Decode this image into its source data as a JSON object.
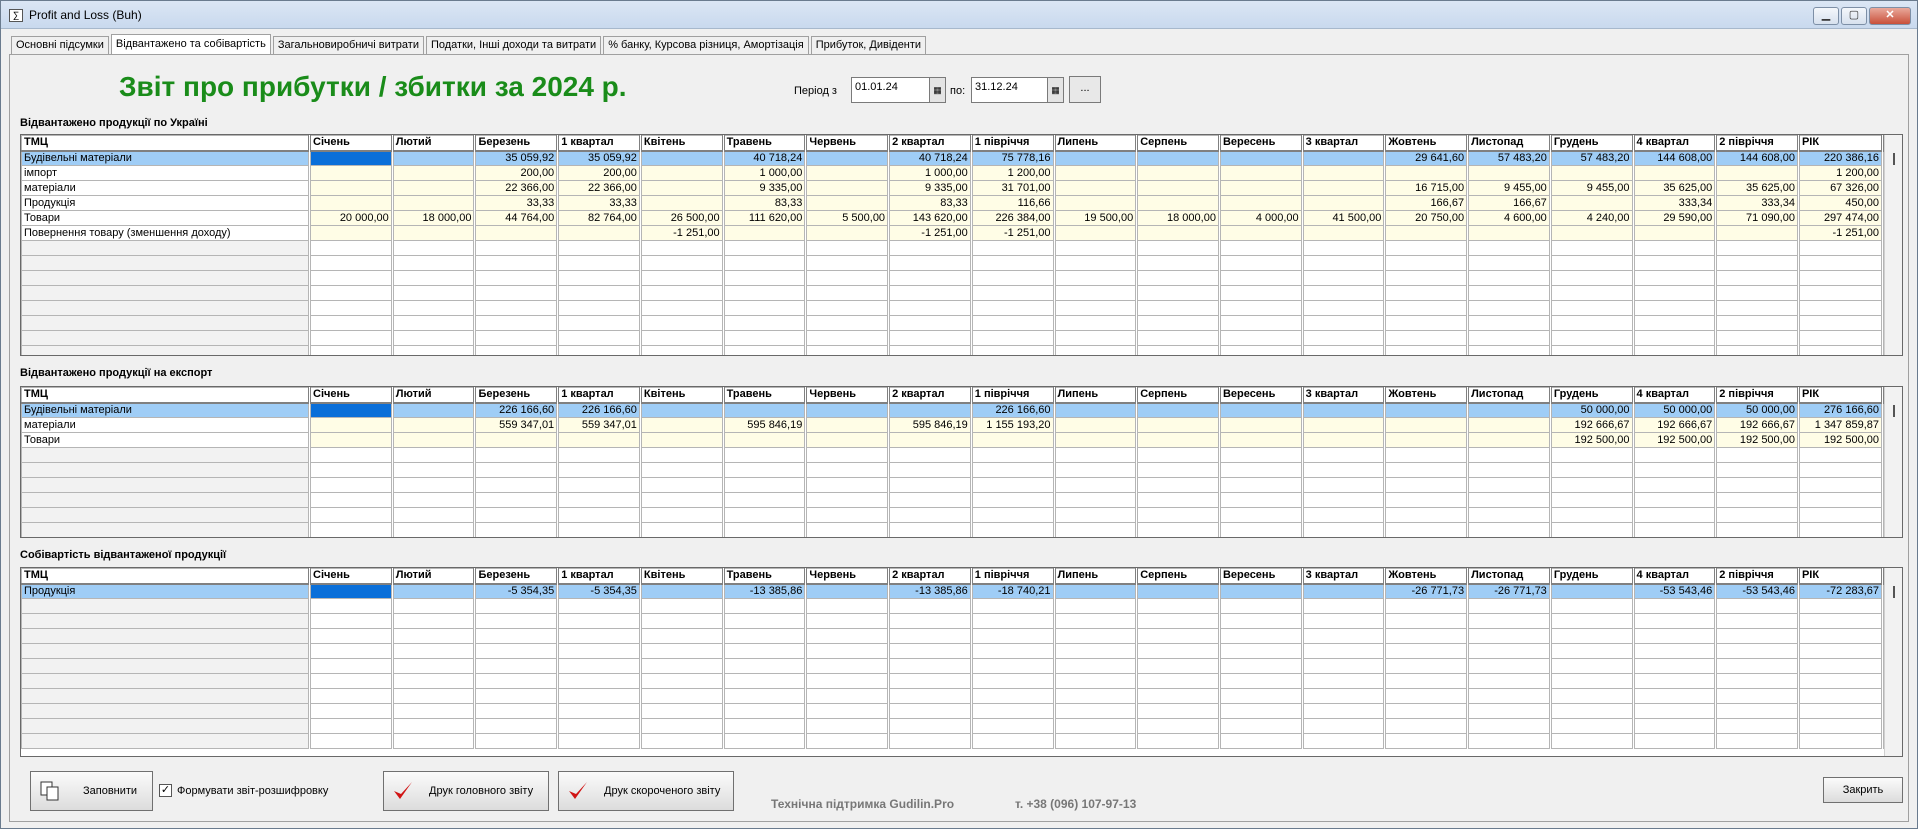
{
  "window": {
    "title": "Profit and Loss (Buh)",
    "icon": "report-icon"
  },
  "tabs": [
    {
      "label": "Основні підсумки"
    },
    {
      "label": "Відвантажено та собівартість"
    },
    {
      "label": "Загальновиробничі витрати"
    },
    {
      "label": "Податки, Інші доходи та витрати"
    },
    {
      "label": "% банку, Курсова різниця, Амортізація"
    },
    {
      "label": "Прибуток, Дивіденти"
    }
  ],
  "active_tab": 1,
  "header": {
    "title": "Звіт про прибутки / збитки за 2024 р.",
    "period_from_label": "Період з",
    "period_from": "01.01.24",
    "period_to_label": "по:",
    "period_to": "31.12.24",
    "dots": "..."
  },
  "columns": [
    "ТМЦ",
    "Січень",
    "Лютий",
    "Березень",
    "1 квартал",
    "Квітень",
    "Травень",
    "Червень",
    "2 квартал",
    "1 півріччя",
    "Липень",
    "Серпень",
    "Вересень",
    "3 квартал",
    "Жовтень",
    "Листопад",
    "Грудень",
    "4 квартал",
    "2 півріччя",
    "РІК"
  ],
  "tables": [
    {
      "title": "Відвантажено продукції по Україні",
      "empty_rows": 8,
      "rows": [
        [
          "Будівельні матеріали",
          "",
          "",
          "35 059,92",
          "35 059,92",
          "",
          "40 718,24",
          "",
          "40 718,24",
          "75 778,16",
          "",
          "",
          "",
          "",
          "29 641,60",
          "57 483,20",
          "57 483,20",
          "144 608,00",
          "144 608,00",
          "220 386,16"
        ],
        [
          "імпорт",
          "",
          "",
          "200,00",
          "200,00",
          "",
          "1 000,00",
          "",
          "1 000,00",
          "1 200,00",
          "",
          "",
          "",
          "",
          "",
          "",
          "",
          "",
          "",
          "1 200,00"
        ],
        [
          "матеріали",
          "",
          "",
          "22 366,00",
          "22 366,00",
          "",
          "9 335,00",
          "",
          "9 335,00",
          "31 701,00",
          "",
          "",
          "",
          "",
          "16 715,00",
          "9 455,00",
          "9 455,00",
          "35 625,00",
          "35 625,00",
          "67 326,00"
        ],
        [
          "Продукція",
          "",
          "",
          "33,33",
          "33,33",
          "",
          "83,33",
          "",
          "83,33",
          "116,66",
          "",
          "",
          "",
          "",
          "166,67",
          "166,67",
          "",
          "333,34",
          "333,34",
          "450,00"
        ],
        [
          "Товари",
          "20 000,00",
          "18 000,00",
          "44 764,00",
          "82 764,00",
          "26 500,00",
          "111 620,00",
          "5 500,00",
          "143 620,00",
          "226 384,00",
          "19 500,00",
          "18 000,00",
          "4 000,00",
          "41 500,00",
          "20 750,00",
          "4 600,00",
          "4 240,00",
          "29 590,00",
          "71 090,00",
          "297 474,00"
        ],
        [
          "Повернення товару (зменшення доходу)",
          "",
          "",
          "",
          "",
          "-1 251,00",
          "",
          "",
          "-1 251,00",
          "-1 251,00",
          "",
          "",
          "",
          "",
          "",
          "",
          "",
          "",
          "",
          "-1 251,00"
        ]
      ]
    },
    {
      "title": "Відвантажено продукції на експорт",
      "empty_rows": 6,
      "rows": [
        [
          "Будівельні матеріали",
          "",
          "",
          "226 166,60",
          "226 166,60",
          "",
          "",
          "",
          "",
          "226 166,60",
          "",
          "",
          "",
          "",
          "",
          "",
          "50 000,00",
          "50 000,00",
          "50 000,00",
          "276 166,60"
        ],
        [
          "матеріали",
          "",
          "",
          "559 347,01",
          "559 347,01",
          "",
          "595 846,19",
          "",
          "595 846,19",
          "1 155 193,20",
          "",
          "",
          "",
          "",
          "",
          "",
          "192 666,67",
          "192 666,67",
          "192 666,67",
          "1 347 859,87"
        ],
        [
          "Товари",
          "",
          "",
          "",
          "",
          "",
          "",
          "",
          "",
          "",
          "",
          "",
          "",
          "",
          "",
          "",
          "192 500,00",
          "192 500,00",
          "192 500,00",
          "192 500,00"
        ]
      ]
    },
    {
      "title": "Собівартість відвантаженої продукції",
      "empty_rows": 10,
      "rows": [
        [
          "Продукція",
          "",
          "",
          "-5 354,35",
          "-5 354,35",
          "",
          "-13 385,86",
          "",
          "-13 385,86",
          "-18 740,21",
          "",
          "",
          "",
          "",
          "-26 771,73",
          "-26 771,73",
          "",
          "-53 543,46",
          "-53 543,46",
          "-72 283,67"
        ]
      ]
    }
  ],
  "footer": {
    "fill_button": "Заповнити",
    "fill_icon": "copy-icon",
    "checkbox_label": "Формувати звіт-розшифровку",
    "checkbox_checked": "✓",
    "print_main": "Друк головного звіту",
    "print_short": "Друк скороченого звіту",
    "print_icon": "red-check-icon",
    "support_text": "Технічна підтримка Gudilin.Pro",
    "phone": "т. +38 (096) 107-97-13",
    "close_button": "Закрить"
  },
  "colors": {
    "title_green": "#1a8c1a",
    "selected_row": "#9fcdf6",
    "current_cell": "#0a6fd9",
    "data_cell": "#fffde6"
  }
}
